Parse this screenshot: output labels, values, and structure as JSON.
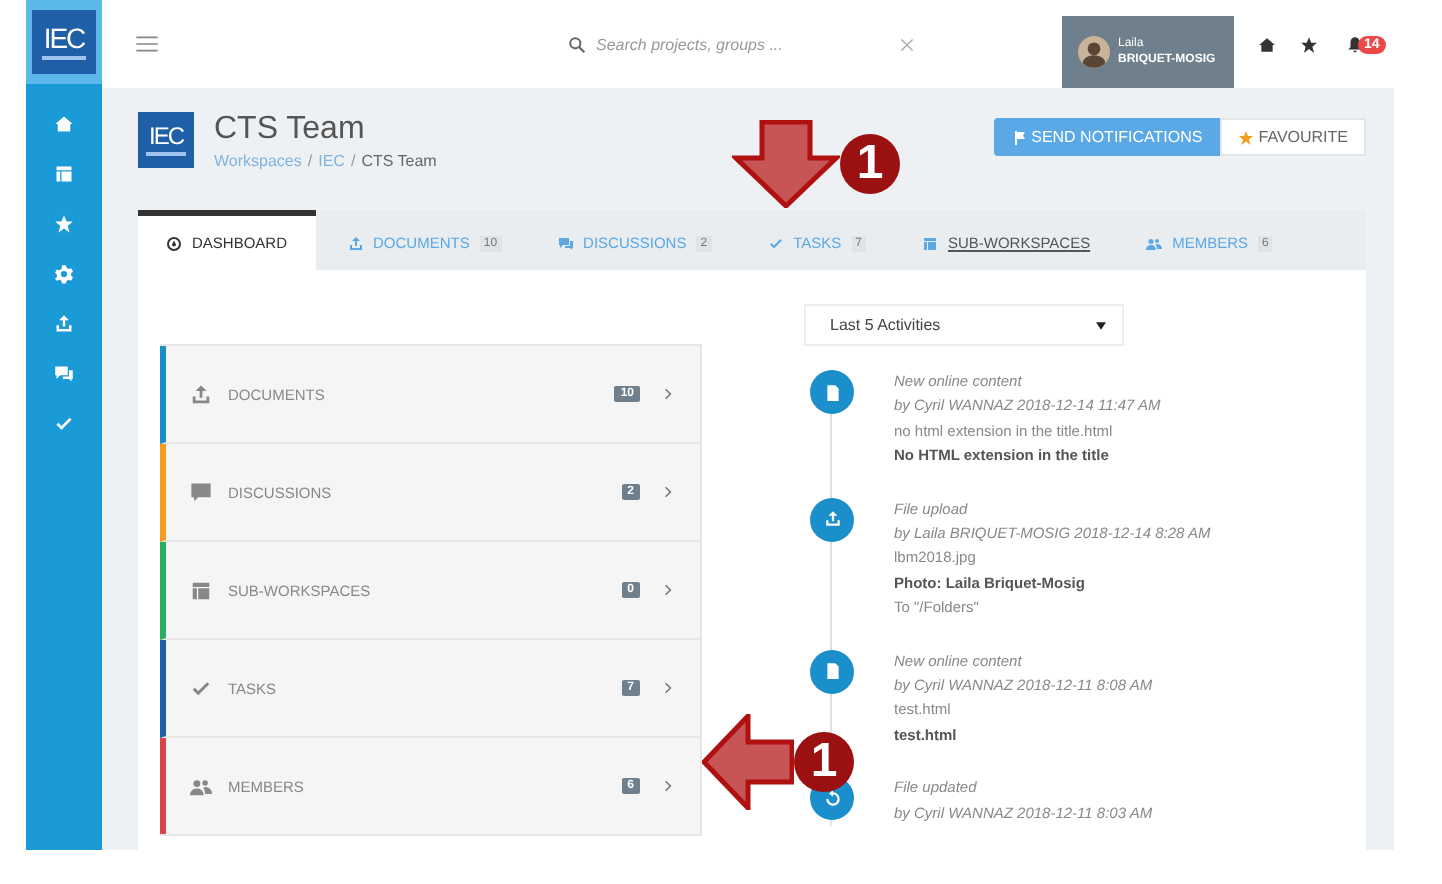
{
  "search": {
    "placeholder": "Search projects, groups ..."
  },
  "user": {
    "first_name": "Laila",
    "last_name": "BRIQUET-MOSIG"
  },
  "notifications": {
    "count": "14"
  },
  "workspace": {
    "title": "CTS Team",
    "logo": "IEC",
    "breadcrumb": [
      {
        "label": "Workspaces",
        "link": true,
        "separator": "/"
      },
      {
        "label": "IEC",
        "link": true,
        "separator": "/"
      },
      {
        "label": "CTS Team",
        "link": false
      }
    ]
  },
  "sidebar_logo": "IEC",
  "buttons": [
    {
      "label": "SEND NOTIFICATIONS",
      "kind": "primary"
    },
    {
      "label": "FAVOURITE",
      "kind": "favourite"
    }
  ],
  "tabs": [
    {
      "label": "DASHBOARD",
      "kind": "dashboard",
      "selected": true,
      "underlined": false
    },
    {
      "label": "DOCUMENTS",
      "kind": "upload",
      "count": "10",
      "selected": false,
      "underlined": false
    },
    {
      "label": "DISCUSSIONS",
      "kind": "chat",
      "count": "2",
      "selected": false,
      "underlined": false
    },
    {
      "label": "TASKS",
      "kind": "check",
      "count": "7",
      "selected": false,
      "underlined": false
    },
    {
      "label": "SUB-WORKSPACES",
      "kind": "table",
      "selected": false,
      "underlined": true
    },
    {
      "label": "MEMBERS",
      "kind": "people",
      "count": "6",
      "selected": false,
      "underlined": false
    }
  ],
  "summary": [
    {
      "label": "DOCUMENTS",
      "kind": "upload",
      "count": "10",
      "color": "#1b8fc4"
    },
    {
      "label": "DISCUSSIONS",
      "kind": "comment",
      "count": "2",
      "color": "#f39c1f"
    },
    {
      "label": "SUB-WORKSPACES",
      "kind": "table",
      "count": "0",
      "color": "#27ae60"
    },
    {
      "label": "TASKS",
      "kind": "check",
      "count": "7",
      "color": "#1f5fa8"
    },
    {
      "label": "MEMBERS",
      "kind": "people",
      "count": "6",
      "color": "#d9434a"
    }
  ],
  "activity_filter": {
    "value": "Last 5 Activities"
  },
  "activities": [
    {
      "kind": "document",
      "title": "New online content",
      "byline": "by Cyril WANNAZ 2018-12-14 11:47 AM",
      "lines": [
        {
          "text": "no html extension in the title.html",
          "bold": false
        },
        {
          "text": "No HTML extension in the title",
          "bold": true
        }
      ]
    },
    {
      "kind": "upload",
      "title": "File upload",
      "byline": "by Laila BRIQUET-MOSIG 2018-12-14 8:28 AM",
      "lines": [
        {
          "text": "lbm2018.jpg",
          "bold": false
        },
        {
          "text": "Photo: Laila Briquet-Mosig",
          "bold": true
        },
        {
          "text": "To \"/Folders\"",
          "bold": false
        }
      ]
    },
    {
      "kind": "document",
      "title": "New online content",
      "byline": "by Cyril WANNAZ 2018-12-11 8:08 AM",
      "lines": [
        {
          "text": "test.html",
          "bold": false
        },
        {
          "text": "test.html",
          "bold": true
        }
      ]
    },
    {
      "kind": "refresh",
      "title": "File updated",
      "byline": "by Cyril WANNAZ 2018-12-11 8:03 AM"
    }
  ],
  "annotations": [
    {
      "label": "1",
      "kind": "down"
    },
    {
      "label": "1",
      "kind": "left"
    }
  ]
}
